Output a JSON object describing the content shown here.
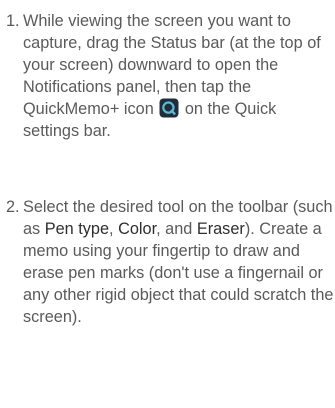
{
  "steps": [
    {
      "number": "1.",
      "text_before_icon": "While viewing the screen you want to capture, drag the Status bar (at the top of your screen) downward to open the Notifications panel, then tap the QuickMemo+ icon",
      "text_after_icon": "on the Quick settings bar.",
      "icon": "quickmemo-plus-icon"
    },
    {
      "number": "2.",
      "text_1": "Select the desired tool on the toolbar (such as",
      "term_1": "Pen type",
      "sep_1": ",",
      "term_2": "Color",
      "sep_2": ", and",
      "term_3": "Eraser",
      "text_2": "). Create a memo using your fingertip to draw and erase pen marks (don't use a fingernail or any other rigid object that could scratch the screen)."
    }
  ],
  "colors": {
    "body_text": "#5a5a5a",
    "bold_text": "#2e2e2e",
    "icon_fill": "#1f2d3a",
    "icon_accent": "#5fb8d2"
  }
}
